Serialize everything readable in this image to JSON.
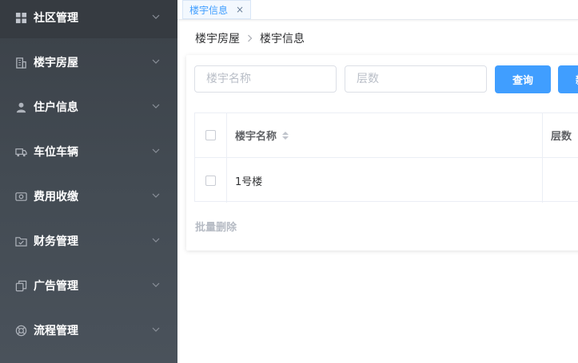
{
  "sidebar": {
    "items": [
      {
        "label": "社区管理",
        "icon": "grid-icon",
        "active": true
      },
      {
        "label": "楼宇房屋",
        "icon": "building-icon"
      },
      {
        "label": "住户信息",
        "icon": "user-icon"
      },
      {
        "label": "车位车辆",
        "icon": "truck-icon"
      },
      {
        "label": "费用收缴",
        "icon": "money-icon"
      },
      {
        "label": "财务管理",
        "icon": "folder-check-icon"
      },
      {
        "label": "广告管理",
        "icon": "copy-icon"
      },
      {
        "label": "流程管理",
        "icon": "lifebuoy-icon"
      }
    ]
  },
  "tabs": [
    {
      "label": "楼宇信息",
      "close": "×"
    }
  ],
  "breadcrumb": {
    "parent": "楼宇房屋",
    "current": "楼宇信息"
  },
  "search": {
    "name_placeholder": "楼宇名称",
    "floor_placeholder": "层数",
    "query_label": "查询",
    "second_label": "新"
  },
  "table": {
    "columns": [
      "楼宇名称",
      "层数"
    ],
    "rows": [
      {
        "name": "1号楼",
        "floor": ""
      }
    ]
  },
  "actions": {
    "batch_delete": "批量删除"
  },
  "colors": {
    "primary": "#409eff",
    "sidebar": "#434b53"
  }
}
